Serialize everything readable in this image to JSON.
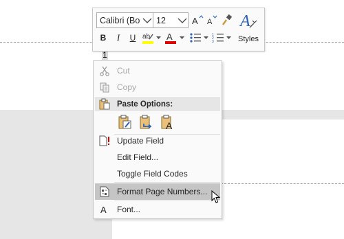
{
  "document": {
    "page_number_field": "1"
  },
  "mini_toolbar": {
    "font_name": "Calibri (Bo",
    "font_size": "12",
    "bold": "B",
    "italic": "I",
    "underline": "U",
    "styles_label": "Styles",
    "highlight_color": "#ffff00",
    "font_color": "#e00000"
  },
  "context_menu": {
    "cut": "Cut",
    "copy": "Copy",
    "paste_options_header": "Paste Options:",
    "update_field": "Update Field",
    "edit_field": "Edit Field...",
    "toggle_field_codes": "Toggle Field Codes",
    "format_page_numbers": "Format Page Numbers...",
    "font": "Font..."
  },
  "icons": {
    "cut": "scissors-icon",
    "copy": "copy-icon",
    "paste": "clipboard-icon",
    "update_field": "update-field-icon",
    "format_page_numbers": "page-number-format-icon",
    "font": "font-icon"
  }
}
